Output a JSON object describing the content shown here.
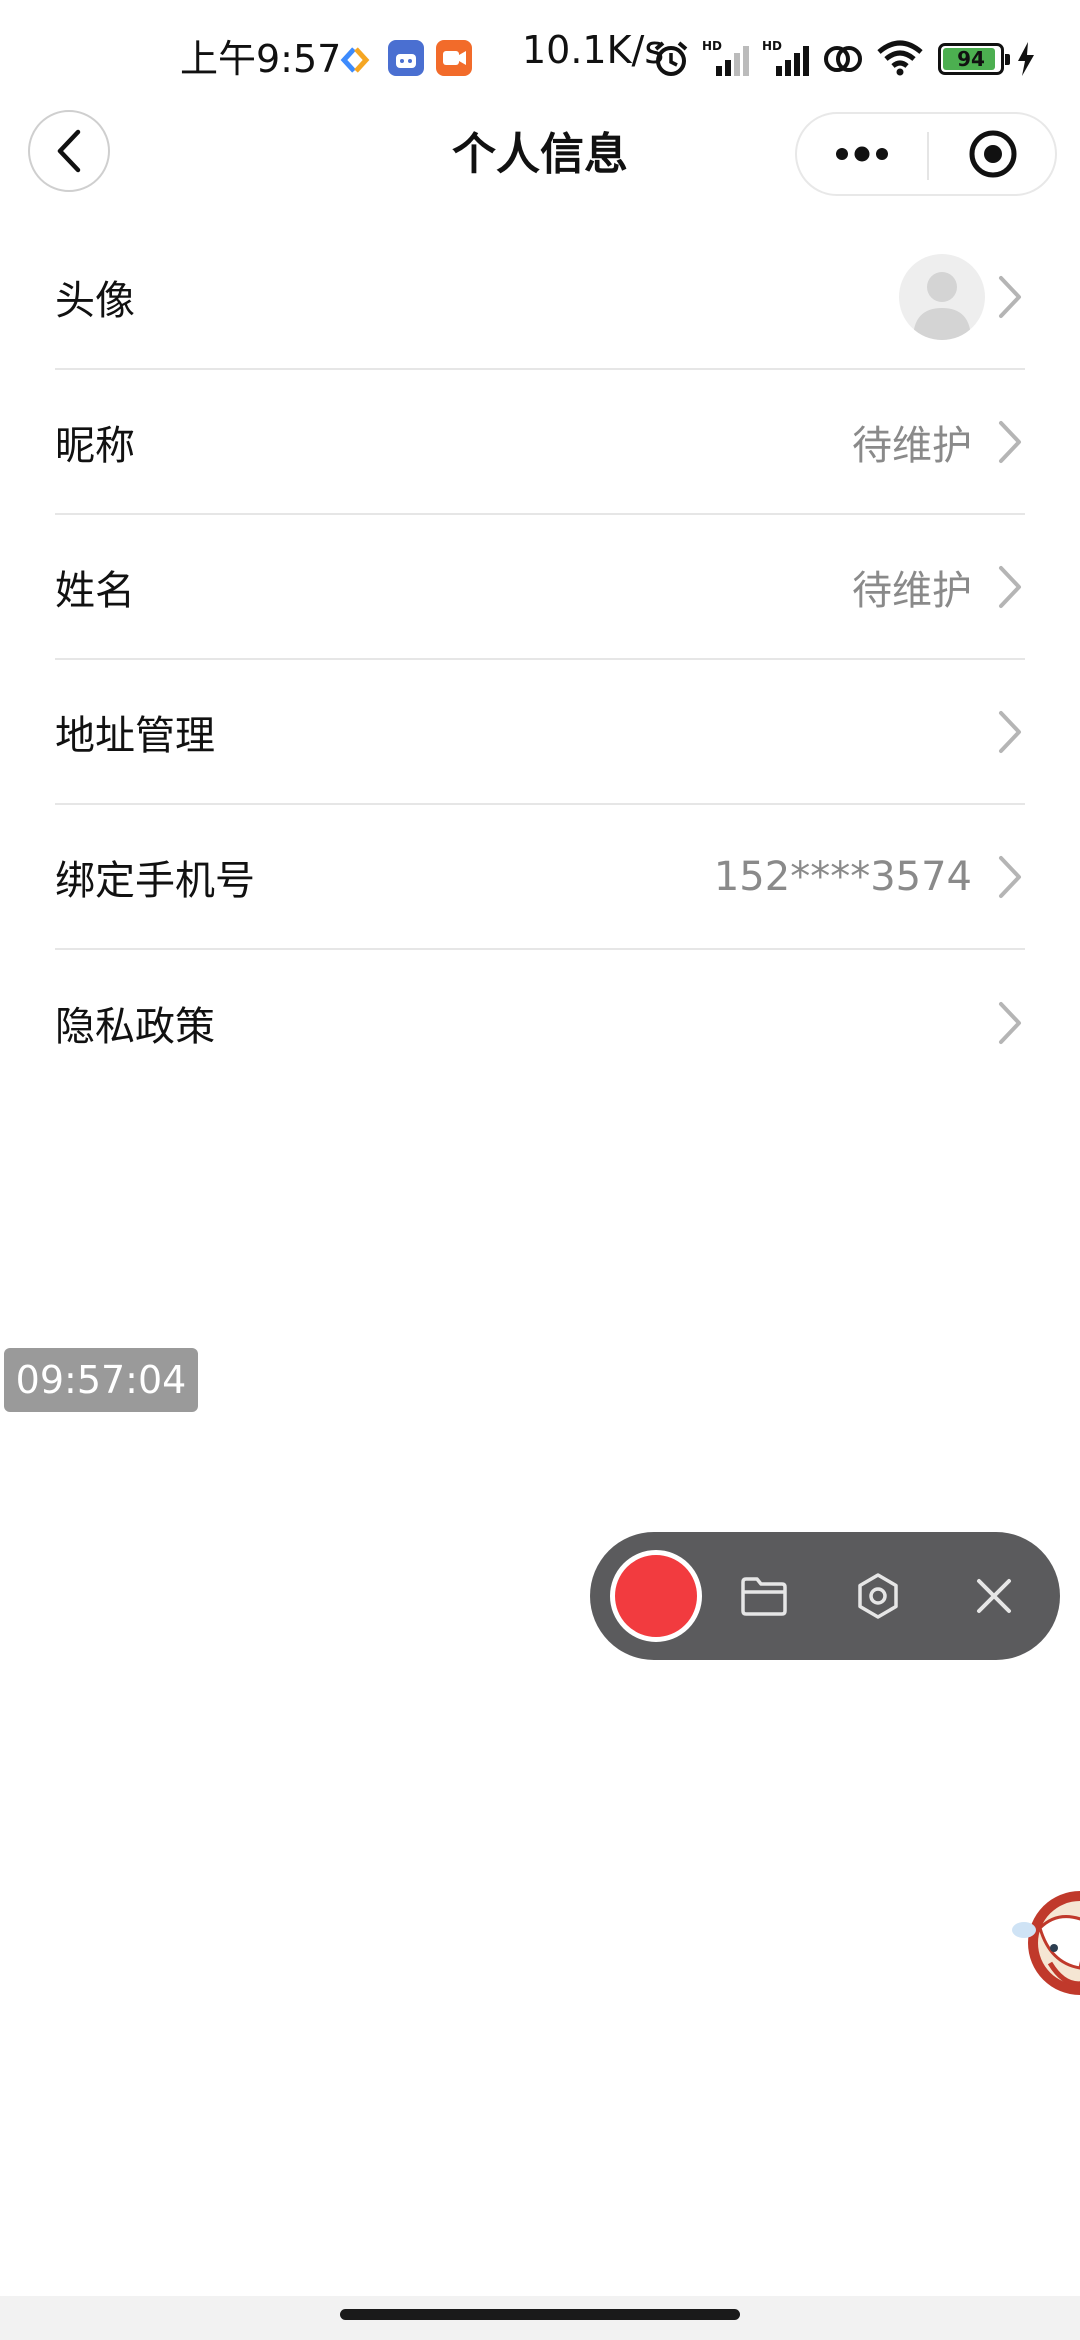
{
  "status_bar": {
    "time": "上午9:57",
    "network_speed": "10.1K/s",
    "battery": "94",
    "battery_color": "#4caf50",
    "icons": [
      "dev-tool-icon",
      "robot-app-icon",
      "video-app-icon",
      "alarm-icon",
      "signal-hd-icon",
      "signal-hd-icon",
      "link-icon",
      "wifi-icon",
      "battery-icon",
      "charging-icon"
    ]
  },
  "header": {
    "title": "个人信息",
    "back_icon": "chevron-left-icon",
    "more_icon": "more-dots-icon",
    "target_icon": "target-icon"
  },
  "profile_items": [
    {
      "label": "头像",
      "value": "",
      "type": "avatar"
    },
    {
      "label": "昵称",
      "value": "待维护"
    },
    {
      "label": "姓名",
      "value": "待维护"
    },
    {
      "label": "地址管理",
      "value": ""
    },
    {
      "label": "绑定手机号",
      "value": "152****3574"
    },
    {
      "label": "隐私政策",
      "value": ""
    }
  ],
  "overlay": {
    "timestamp": "09:57:04"
  },
  "recorder_toolbar": {
    "record_color": "#f23b3f",
    "tools": [
      "folder-icon",
      "settings-hex-icon",
      "close-icon"
    ]
  }
}
